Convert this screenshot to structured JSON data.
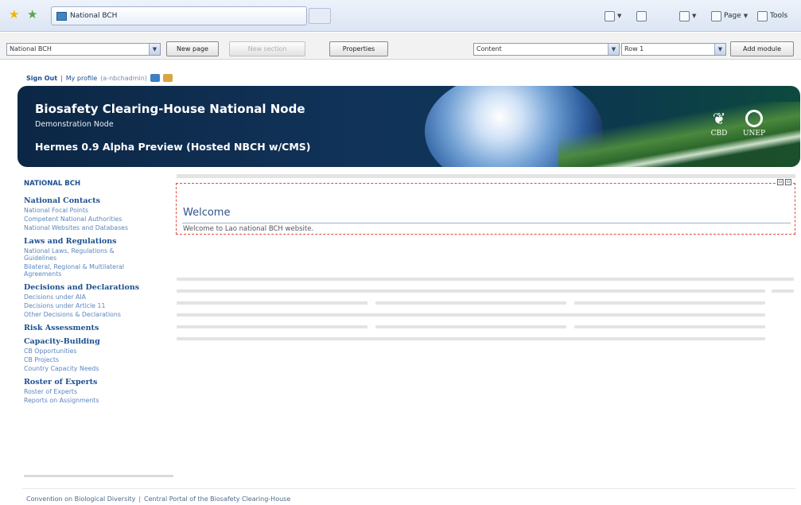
{
  "browser": {
    "tab_title": "National BCH",
    "page_label": "Page",
    "tools_label": "Tools"
  },
  "toolbar": {
    "page_select": "National BCH",
    "new_page": "New page",
    "new_section": "New section",
    "properties": "Properties",
    "pane_select": "Content",
    "row_select": "Row 1",
    "add_module": "Add module"
  },
  "user": {
    "sign_out": "Sign Out",
    "separator": "|",
    "my_profile": "My profile",
    "username": "(a-nbchadmin)"
  },
  "banner": {
    "title": "Biosafety Clearing-House National Node",
    "subtitle": "Demonstration Node",
    "version": "Hermes 0.9 Alpha Preview (Hosted NBCH w/CMS)",
    "cbd": "CBD",
    "unep": "UNEP"
  },
  "nav": {
    "home": "NATIONAL BCH",
    "sections": [
      {
        "title": "National Contacts",
        "links": [
          "National Focal Points",
          "Competent National Authorities",
          "National Websites and Databases"
        ]
      },
      {
        "title": "Laws and Regulations",
        "links": [
          "National Laws, Regulations &",
          "Guidelines",
          "Bilateral, Regional & Multilateral",
          "Agreements"
        ]
      },
      {
        "title": "Decisions and Declarations",
        "links": [
          "Decisions under AIA",
          "Decisions under Article 11",
          "Other Decisions & Declarations"
        ]
      },
      {
        "title": "Risk Assessments",
        "links": []
      },
      {
        "title": "Capacity-Building",
        "links": [
          "CB Opportunities",
          "CB Projects",
          "Country Capacity Needs"
        ]
      },
      {
        "title": "Roster of Experts",
        "links": [
          "Roster of Experts",
          "Reports on Assignments"
        ]
      }
    ]
  },
  "module": {
    "heading": "Welcome",
    "text": "Welcome to Lao national BCH website."
  },
  "footer": {
    "cbd": "Convention on Biological Diversity",
    "separator": "|",
    "portal": "Central Portal of the Biosafety Clearing-House"
  }
}
